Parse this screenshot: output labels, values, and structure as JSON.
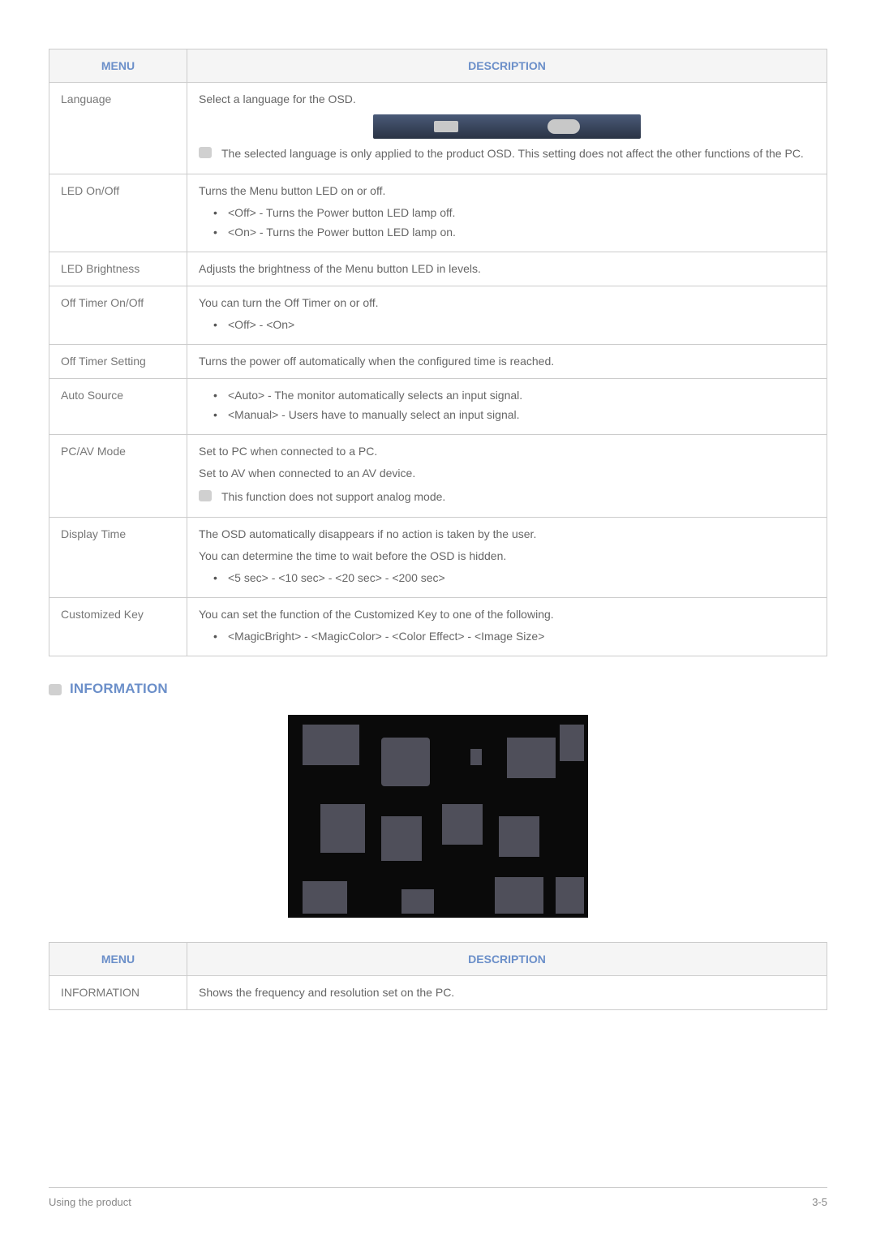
{
  "table1": {
    "headers": {
      "menu": "MENU",
      "description": "DESCRIPTION"
    },
    "rows": [
      {
        "menu": "Language",
        "intro": "Select a language for the OSD.",
        "note": "The selected language is only applied to the product OSD. This setting does not affect the other functions of the PC."
      },
      {
        "menu": "LED On/Off",
        "intro": "Turns the Menu button LED on or off.",
        "bullets": [
          "<Off> - Turns the Power button LED lamp off.",
          "<On> - Turns the Power button LED lamp on."
        ]
      },
      {
        "menu": "LED Brightness",
        "intro": "Adjusts the brightness of the Menu button LED in levels."
      },
      {
        "menu": "Off Timer On/Off",
        "intro": "You can turn the Off Timer on or off.",
        "bullets": [
          "<Off> - <On>"
        ]
      },
      {
        "menu": "Off Timer Setting",
        "intro": "Turns the power off automatically when the configured time is reached."
      },
      {
        "menu": "Auto Source",
        "bullets": [
          "<Auto> - The monitor automatically selects an input signal.",
          "<Manual> - Users have to manually select an input signal."
        ]
      },
      {
        "menu": "PC/AV Mode",
        "intro": "Set to PC when connected to a PC.",
        "intro2": "Set to AV when connected to an AV device.",
        "note": "This function does not support analog mode."
      },
      {
        "menu": "Display Time",
        "intro": "The OSD automatically disappears if no action is taken by the user.",
        "intro2": "You can determine the time to wait before the OSD is hidden.",
        "bullets": [
          "<5 sec> - <10 sec> - <20 sec> - <200 sec>"
        ]
      },
      {
        "menu": "Customized Key",
        "intro": "You can set the function of the Customized Key to one of the following.",
        "bullets": [
          "<MagicBright> - <MagicColor> - <Color Effect> - <Image Size>"
        ]
      }
    ]
  },
  "section_heading": "INFORMATION",
  "table2": {
    "headers": {
      "menu": "MENU",
      "description": "DESCRIPTION"
    },
    "row": {
      "menu": "INFORMATION",
      "desc": "Shows the frequency and resolution set on the PC."
    }
  },
  "footer": {
    "left": "Using the product",
    "right": "3-5"
  }
}
